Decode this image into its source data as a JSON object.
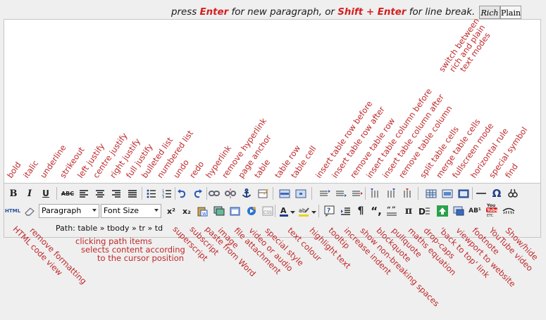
{
  "hint": {
    "pre": "press ",
    "enter": "Enter",
    "mid": " for new paragraph, or ",
    "shift": "Shift + Enter",
    "post": " for line break."
  },
  "modes": {
    "rich": "Rich",
    "plain": "Plain"
  },
  "toolbar": {
    "bold": "B",
    "italic": "I",
    "underline": "U",
    "strike": "ABC",
    "html": "HTML",
    "superscript": "x²",
    "subscript": "x₂",
    "format_value": "Paragraph",
    "size_value": "Font Size",
    "paragraph": "¶",
    "quote": "“,",
    "pi": "π",
    "omega": "Ω",
    "ab": "AB¹",
    "youtube": "You\nTube",
    "hr": "—"
  },
  "path": "Path: table » tbody » tr » td",
  "labels_up": [
    "bold",
    "italic",
    "underline",
    "strikeout",
    "left justify",
    "centre justify",
    "right justify",
    "full justify",
    "bulleted list",
    "numbered list",
    "undo",
    "redo",
    "hyperlink",
    "remove hyperlink",
    "page anchor",
    "table",
    "table row",
    "table cell",
    "insert table row before",
    "insert table row after",
    "remove table row",
    "insert table column before",
    "insert table column after",
    "remove table column",
    "split table cells",
    "merge table cells",
    "fullscreen mode",
    "horizontal rule",
    "special symbol",
    "find"
  ],
  "labels_down": [
    "HTML code view",
    "remove formatting",
    "paste from Word",
    "subscript",
    "superscript",
    "image",
    "file attachment",
    "video or audio",
    "special style",
    "text colour",
    "highlight text",
    "tooltip",
    "increase indent",
    "show non-breaking spaces",
    "blockquote",
    "pullquote",
    "maths equation",
    "drop-caps",
    "'back to top' link",
    "viewport to website",
    "footnote",
    "YouTube video",
    "Show/hide"
  ],
  "labels_plain": {
    "switch1": "switch between",
    "switch2": "rich and plain",
    "switch3": "text modes",
    "path1": "clicking path items",
    "path2": "selects content according",
    "path3": "to the cursor position"
  }
}
